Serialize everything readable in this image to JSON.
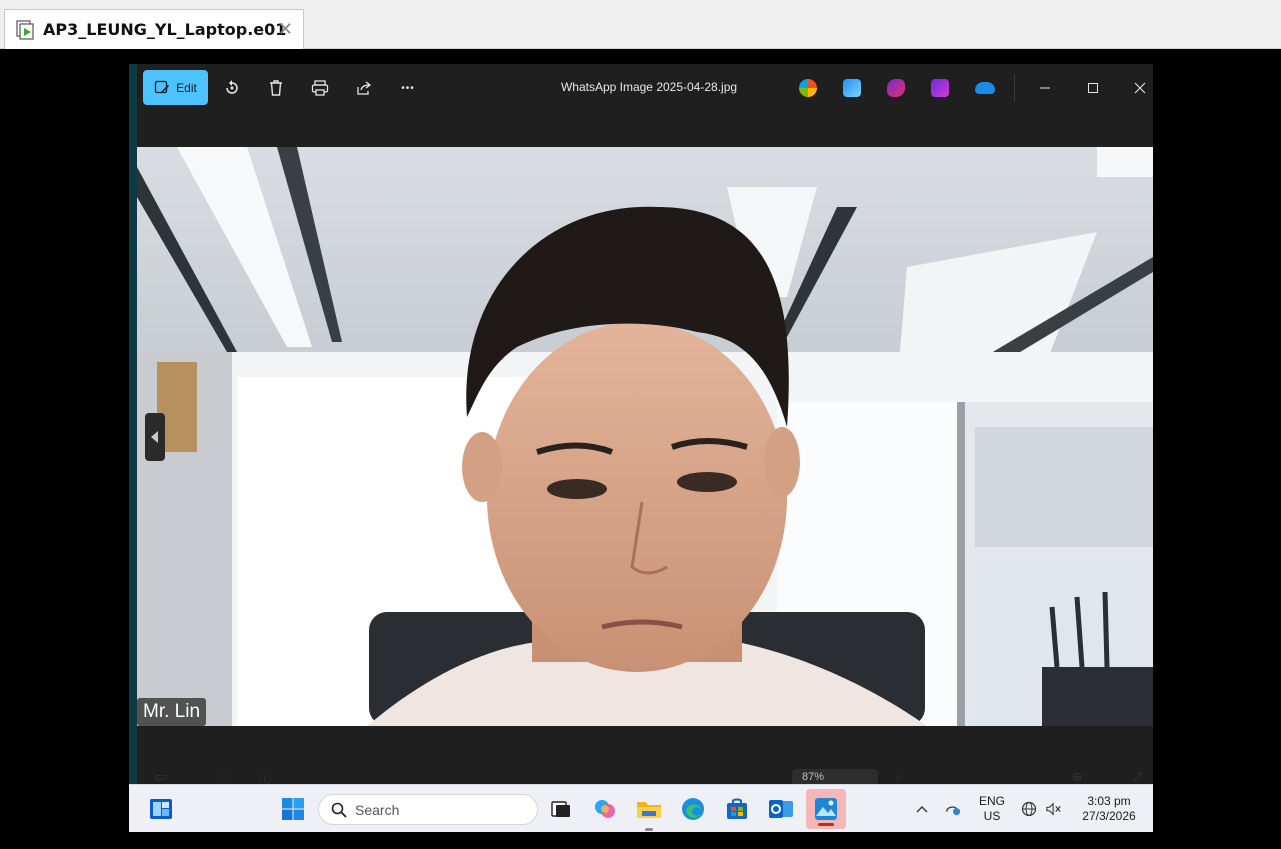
{
  "viewer": {
    "tab_label": "AP3_LEUNG_YL_Laptop.e01",
    "tab_close": "✕"
  },
  "photos": {
    "edit_label": "Edit",
    "file_title": "WhatsApp Image 2025-04-28.jpg",
    "more_label": "•••",
    "name_tag": "Mr. Lin",
    "zoom_value": "87%"
  },
  "taskbar": {
    "search_placeholder": "Search",
    "lang_top": "ENG",
    "lang_bottom": "US",
    "time": "3:03 pm",
    "date": "27/3/2026"
  },
  "colors": {
    "accent": "#4cc2ff",
    "window_bg": "#1f1f1f",
    "taskbar_bg": "#eef0f6"
  }
}
